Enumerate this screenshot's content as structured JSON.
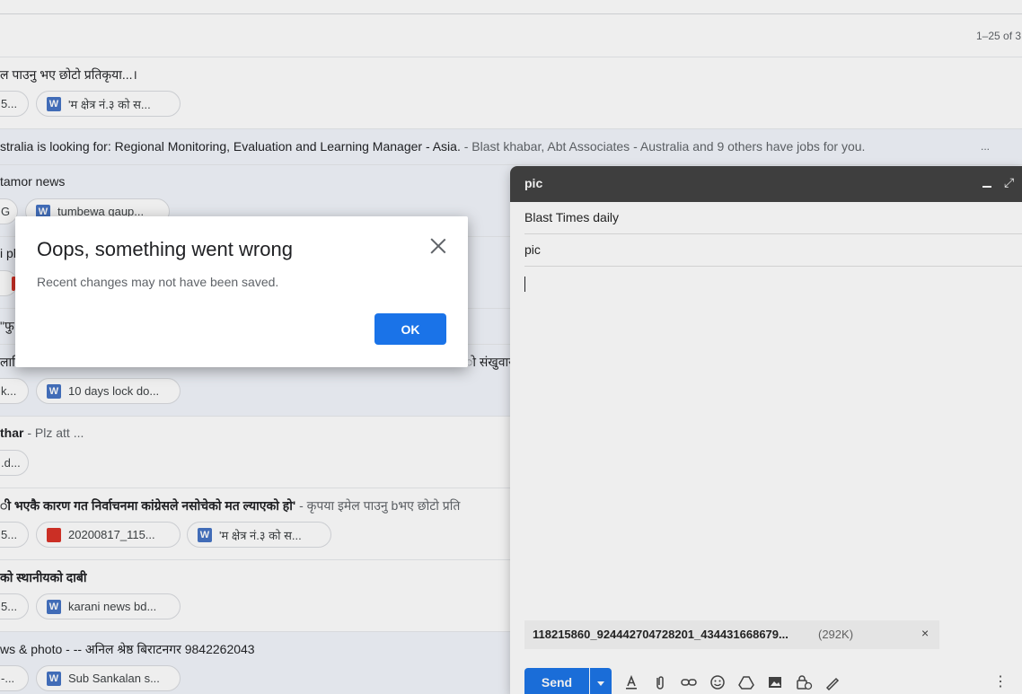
{
  "inbox": {
    "pagination": "1–25 of 3",
    "rows": [
      {
        "line_plain": "ल पाउनु भए छोटो प्रतिकृया...।",
        "chips": [
          "5...",
          "'म क्षेत्र नं.३ को स..."
        ]
      },
      {
        "line_bold": "stralia is looking for: Regional Monitoring, Evaluation and Learning Manager - Asia.",
        "line_snippet": " - Blast khabar, Abt Associates - Australia and 9 others have jobs for you.",
        "more": "..."
      },
      {
        "line_plain": "tamor news",
        "chips": [
          "G",
          "tumbewa gaup..."
        ]
      },
      {
        "line_plain": "i ph",
        "chips": [
          "",
          ""
        ]
      },
      {
        "line_plain": "\"फु",
        "chips": []
      },
      {
        "line_plain": "लागि",
        "line_tail": "ो संखुवार",
        "chips": [
          "k...",
          "10 days lock do..."
        ]
      },
      {
        "line_bold": "thar",
        "line_snippet": " - Plz att ...",
        "chips": [
          ".d..."
        ]
      },
      {
        "line_bold": "ी भएकै कारण गत निर्वाचनमा कांग्रेसले नसोचेको मत ल्याएको हो'",
        "line_snippet": " - कृपया इमेल पाउनु bभए छोटो प्रति",
        "chips": [
          "5...",
          "20200817_115...",
          "'म क्षेत्र नं.३ को स..."
        ]
      },
      {
        "line_bold": "को स्थानीयको दाबी",
        "chips": [
          "5...",
          "karani news bd..."
        ]
      },
      {
        "line_plain": "ws & photo - -- अनिल श्रेष्ठ बिराटनगर 9842262043",
        "chips": [
          "-...",
          "Sub Sankalan s..."
        ]
      }
    ]
  },
  "compose": {
    "title": "pic",
    "to": "Blast Times daily",
    "subject": "pic",
    "attachment": {
      "name": "118215860_924442704728201_434431668679...",
      "size": "(292K)",
      "remove": "×"
    },
    "send_label": "Send",
    "icons": [
      "format-text-icon",
      "attach-file-icon",
      "insert-link-icon",
      "emoji-icon",
      "drive-icon",
      "insert-photo-icon",
      "confidential-mode-icon",
      "signature-icon",
      "more-options-icon"
    ]
  },
  "dialog": {
    "title": "Oops, something went wrong",
    "message": "Recent changes may not have been saved.",
    "ok_label": "OK"
  },
  "colors": {
    "accent": "#1a73e8",
    "compose_header": "#404040",
    "word_icon": "#4472c4",
    "image_icon": "#d93025"
  }
}
